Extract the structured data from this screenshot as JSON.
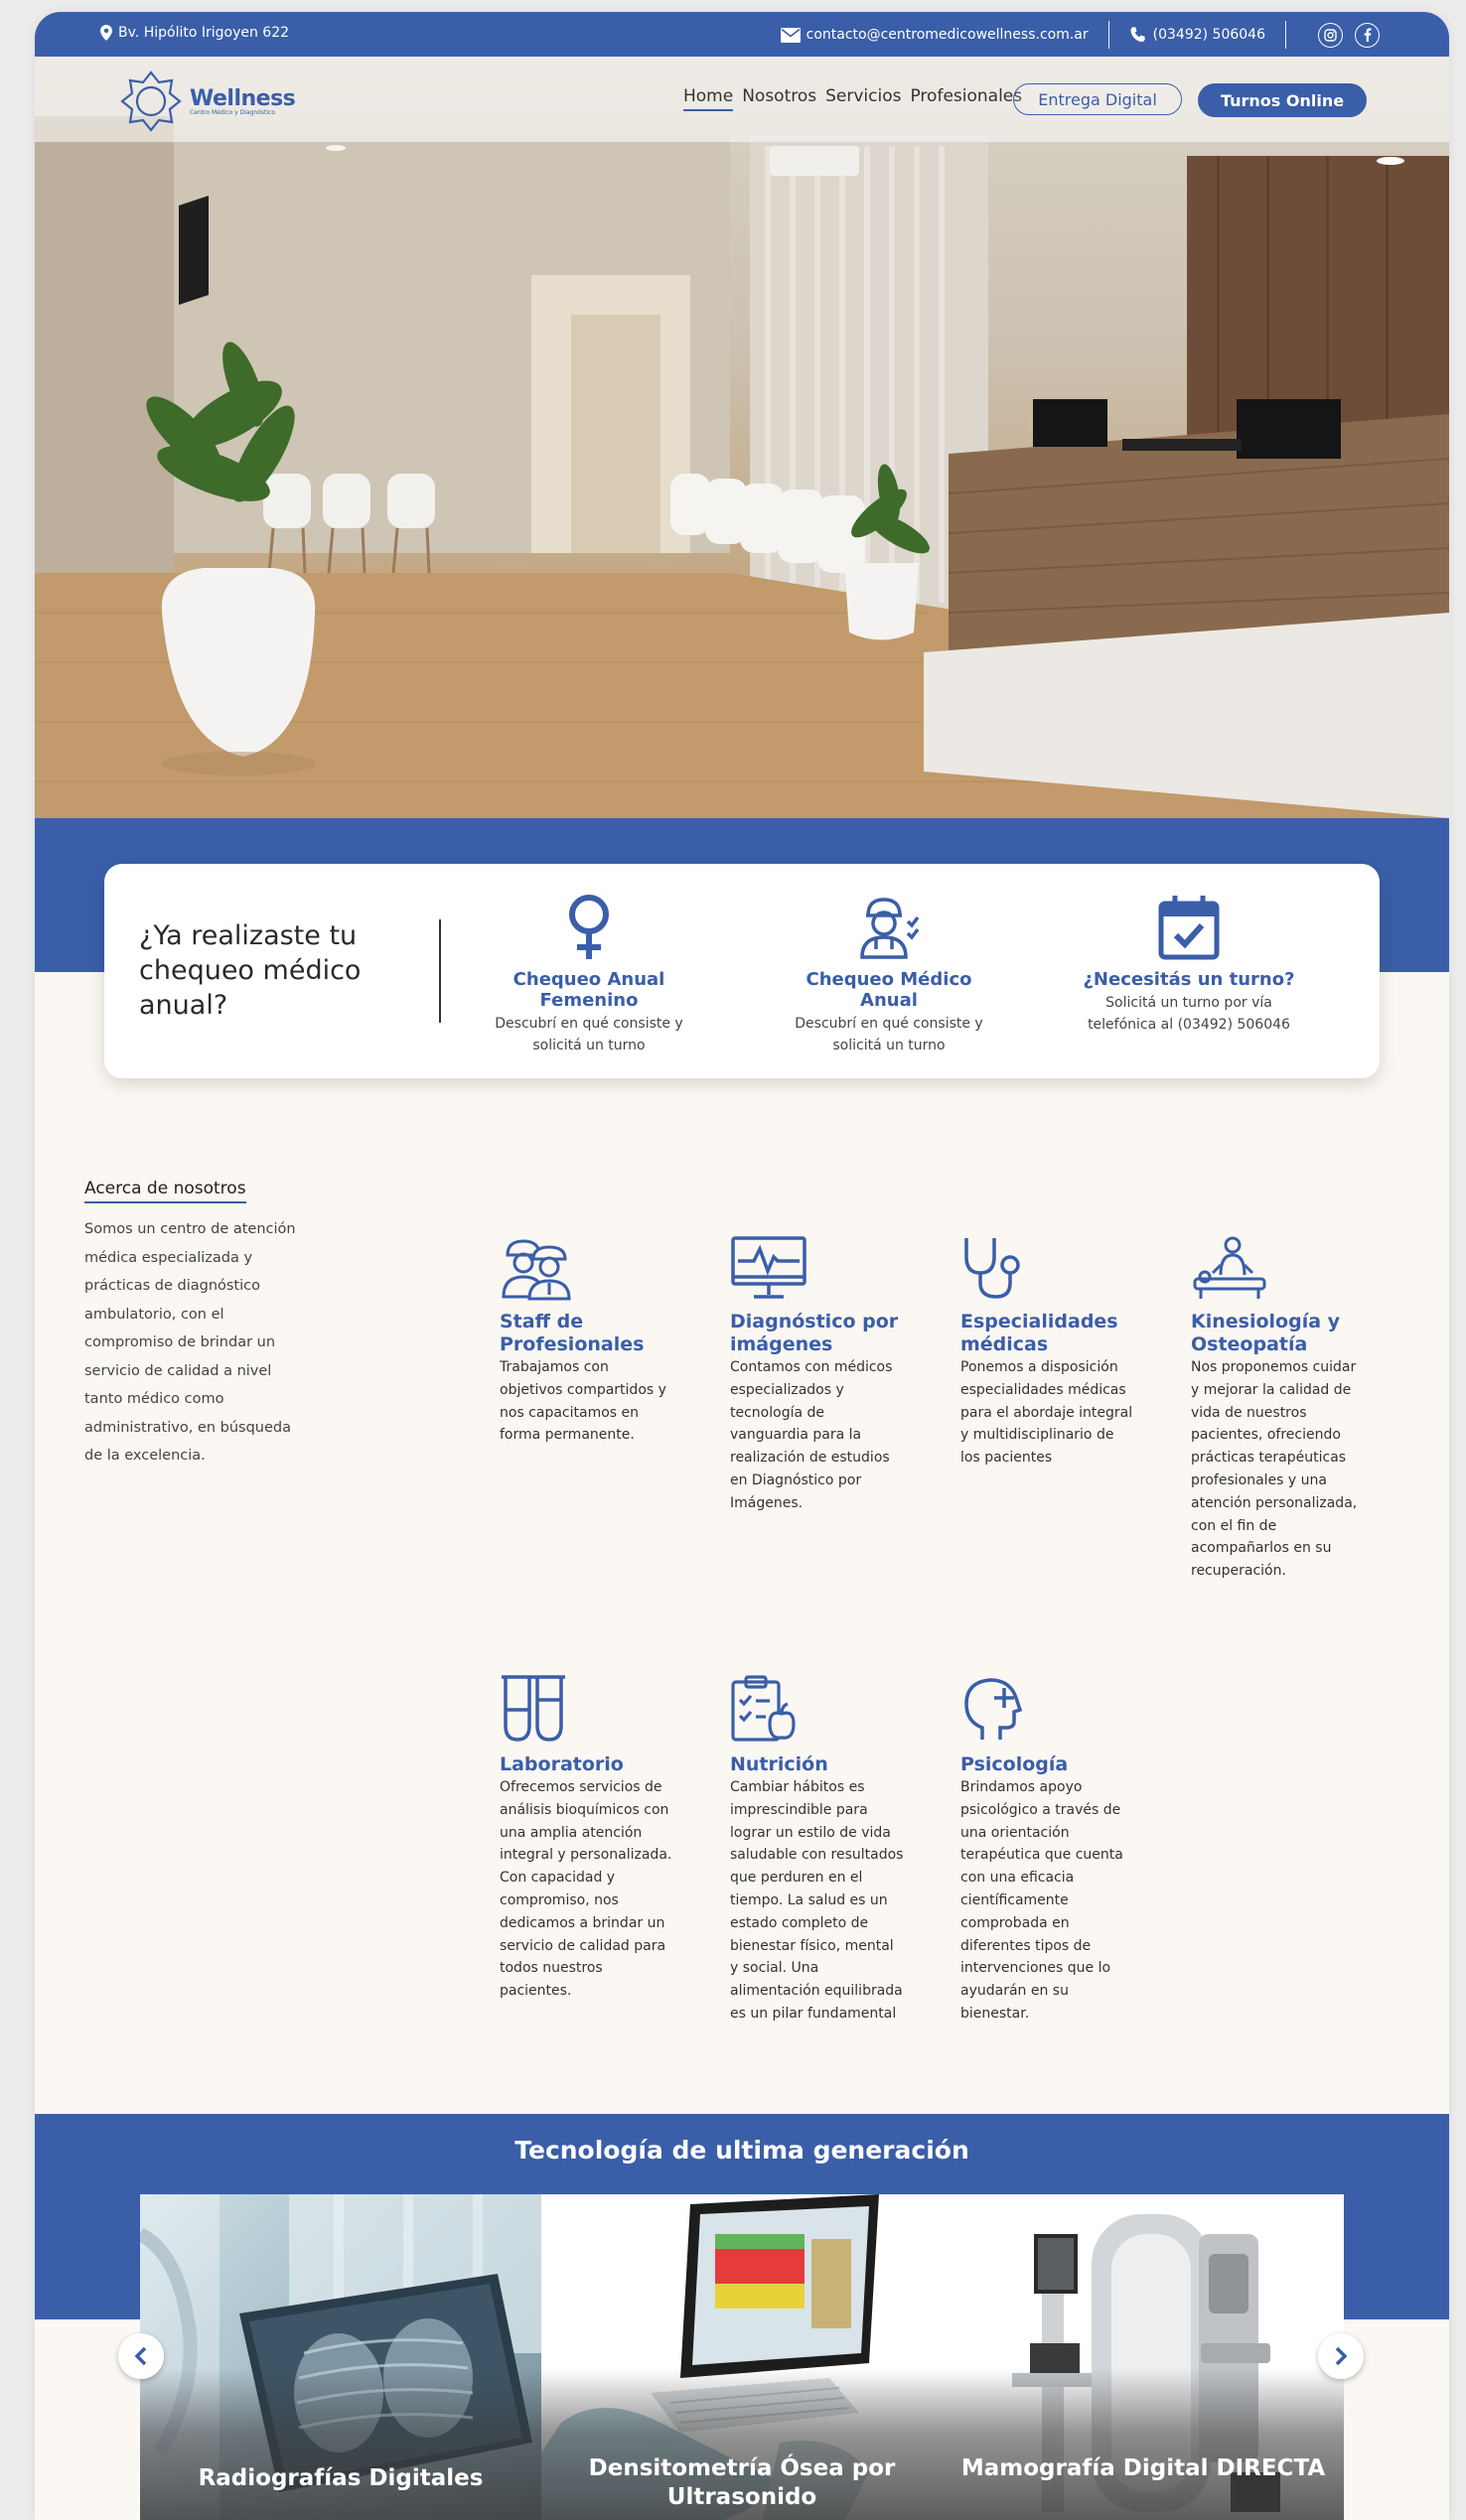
{
  "colors": {
    "primary": "#3a5ea8",
    "background": "#fbf7f2",
    "text": "#333333"
  },
  "topbar": {
    "address": "Bv. Hipólito Irigoyen 622",
    "email": "contacto@centromedicowellness.com.ar",
    "phone": "(03492) 506046",
    "icons": [
      "location-pin-icon",
      "mail-icon",
      "phone-icon",
      "instagram-icon",
      "facebook-icon"
    ]
  },
  "header": {
    "logo_name": "Wellness",
    "logo_subtitle": "Centro Médico y Diagnóstico",
    "nav": [
      "Home",
      "Nosotros",
      "Servicios",
      "Profesionales"
    ],
    "active_nav": "Home",
    "btn_digital": "Entrega Digital",
    "btn_turnos": "Turnos Online"
  },
  "checkup": {
    "title": "¿Ya realizaste tu chequeo médico anual?",
    "items": [
      {
        "icon": "female-symbol-icon",
        "title": "Chequeo Anual Femenino",
        "desc": "Descubrí en qué consiste y solicitá un turno"
      },
      {
        "icon": "doctor-icon",
        "title": "Chequeo Médico Anual",
        "desc": "Descubrí en qué consiste y solicitá un turno"
      },
      {
        "icon": "calendar-check-icon",
        "title": "¿Necesitás un turno?",
        "desc": "Solicitá un turno por vía telefónica al (03492) 506046"
      }
    ]
  },
  "about": {
    "heading": "Acerca de nosotros",
    "text": "Somos un centro de atención médica especializada y prácticas de diagnóstico ambulatorio, con el compromiso de brindar un servicio de calidad a nivel tanto médico como administrativo, en búsqueda de la excelencia."
  },
  "services": [
    {
      "icon": "staff-icon",
      "title": "Staff de Profesionales",
      "desc": "Trabajamos con objetivos compartidos y nos capacitamos en forma permanente."
    },
    {
      "icon": "monitor-pulse-icon",
      "title": "Diagnóstico por imágenes",
      "desc": "Contamos con médicos especializados y tecnología de vanguardia para la realización de estudios en Diagnóstico por Imágenes."
    },
    {
      "icon": "stethoscope-icon",
      "title": "Especialidades médicas",
      "desc": "Ponemos a disposición especialidades médicas para el abordaje integral y multidisciplinario de los pacientes"
    },
    {
      "icon": "massage-icon",
      "title": "Kinesiología y Osteopatía",
      "desc": "Nos proponemos cuidar y mejorar la calidad de vida de nuestros pacientes, ofreciendo prácticas terapéuticas profesionales y una atención personalizada, con el fin de acompañarlos en su recuperación."
    },
    {
      "icon": "test-tubes-icon",
      "title": "Laboratorio",
      "desc": "Ofrecemos servicios de análisis bioquímicos con una amplia atención integral y personalizada. Con capacidad y compromiso, nos dedicamos a brindar un servicio de calidad para todos nuestros pacientes."
    },
    {
      "icon": "clipboard-apple-icon",
      "title": "Nutrición",
      "desc": "Cambiar hábitos es imprescindible para lograr un estilo de vida saludable con resultados que perduren en el tiempo. La salud es un estado completo de bienestar físico, mental y social. Una alimentación equilibrada es un pilar fundamental"
    },
    {
      "icon": "head-plus-icon",
      "title": "Psicología",
      "desc": "Brindamos apoyo psicológico a través de una orientación terapéutica que cuenta con una eficacia científicamente comprobada en diferentes tipos de intervenciones que lo ayudarán en su bienestar."
    }
  ],
  "tech": {
    "title": "Tecnología de ultima generación",
    "slides": [
      {
        "caption": "Radiografías Digitales"
      },
      {
        "caption": "Densitometría Ósea por Ultrasonido"
      },
      {
        "caption": "Mamografía Digital DIRECTA"
      }
    ],
    "prev_icon": "chevron-left-icon",
    "next_icon": "chevron-right-icon"
  }
}
